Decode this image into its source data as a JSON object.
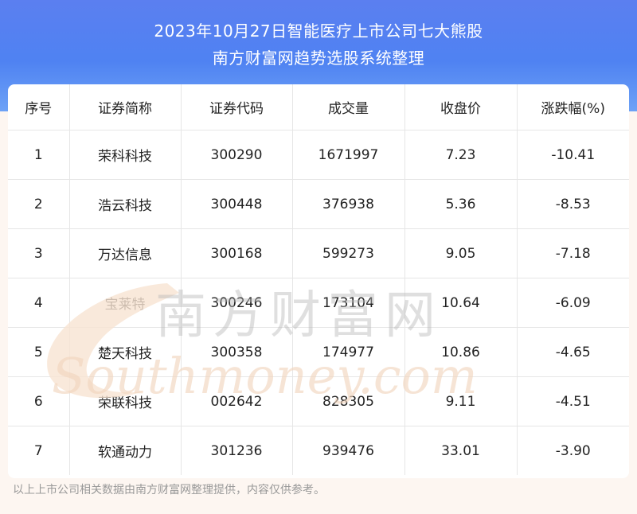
{
  "header": {
    "title_line1": "2023年10月27日智能医疗上市公司七大熊股",
    "title_line2": "南方财富网趋势选股系统整理"
  },
  "table": {
    "columns": [
      "序号",
      "证券简称",
      "证券代码",
      "成交量",
      "收盘价",
      "涨跌幅(%)"
    ],
    "rows": [
      [
        "1",
        "荣科科技",
        "300290",
        "1671997",
        "7.23",
        "-10.41"
      ],
      [
        "2",
        "浩云科技",
        "300448",
        "376938",
        "5.36",
        "-8.53"
      ],
      [
        "3",
        "万达信息",
        "300168",
        "599273",
        "9.05",
        "-7.18"
      ],
      [
        "4",
        "宝莱特",
        "300246",
        "173104",
        "10.64",
        "-6.09"
      ],
      [
        "5",
        "楚天科技",
        "300358",
        "174977",
        "10.86",
        "-4.65"
      ],
      [
        "6",
        "荣联科技",
        "002642",
        "828305",
        "9.11",
        "-4.51"
      ],
      [
        "7",
        "软通动力",
        "301236",
        "939476",
        "33.01",
        "-3.90"
      ]
    ]
  },
  "watermark": {
    "cn": "南方财富网",
    "en": "Southmoney.com"
  },
  "footnote": "以上上市公司相关数据由南方财富网整理提供，内容仅供参考。",
  "colors": {
    "header_top": "#5b7ff0",
    "header_bottom": "#6da2f6",
    "page_bg": "#fdf6f1",
    "watermark": "#b9b9b9"
  }
}
